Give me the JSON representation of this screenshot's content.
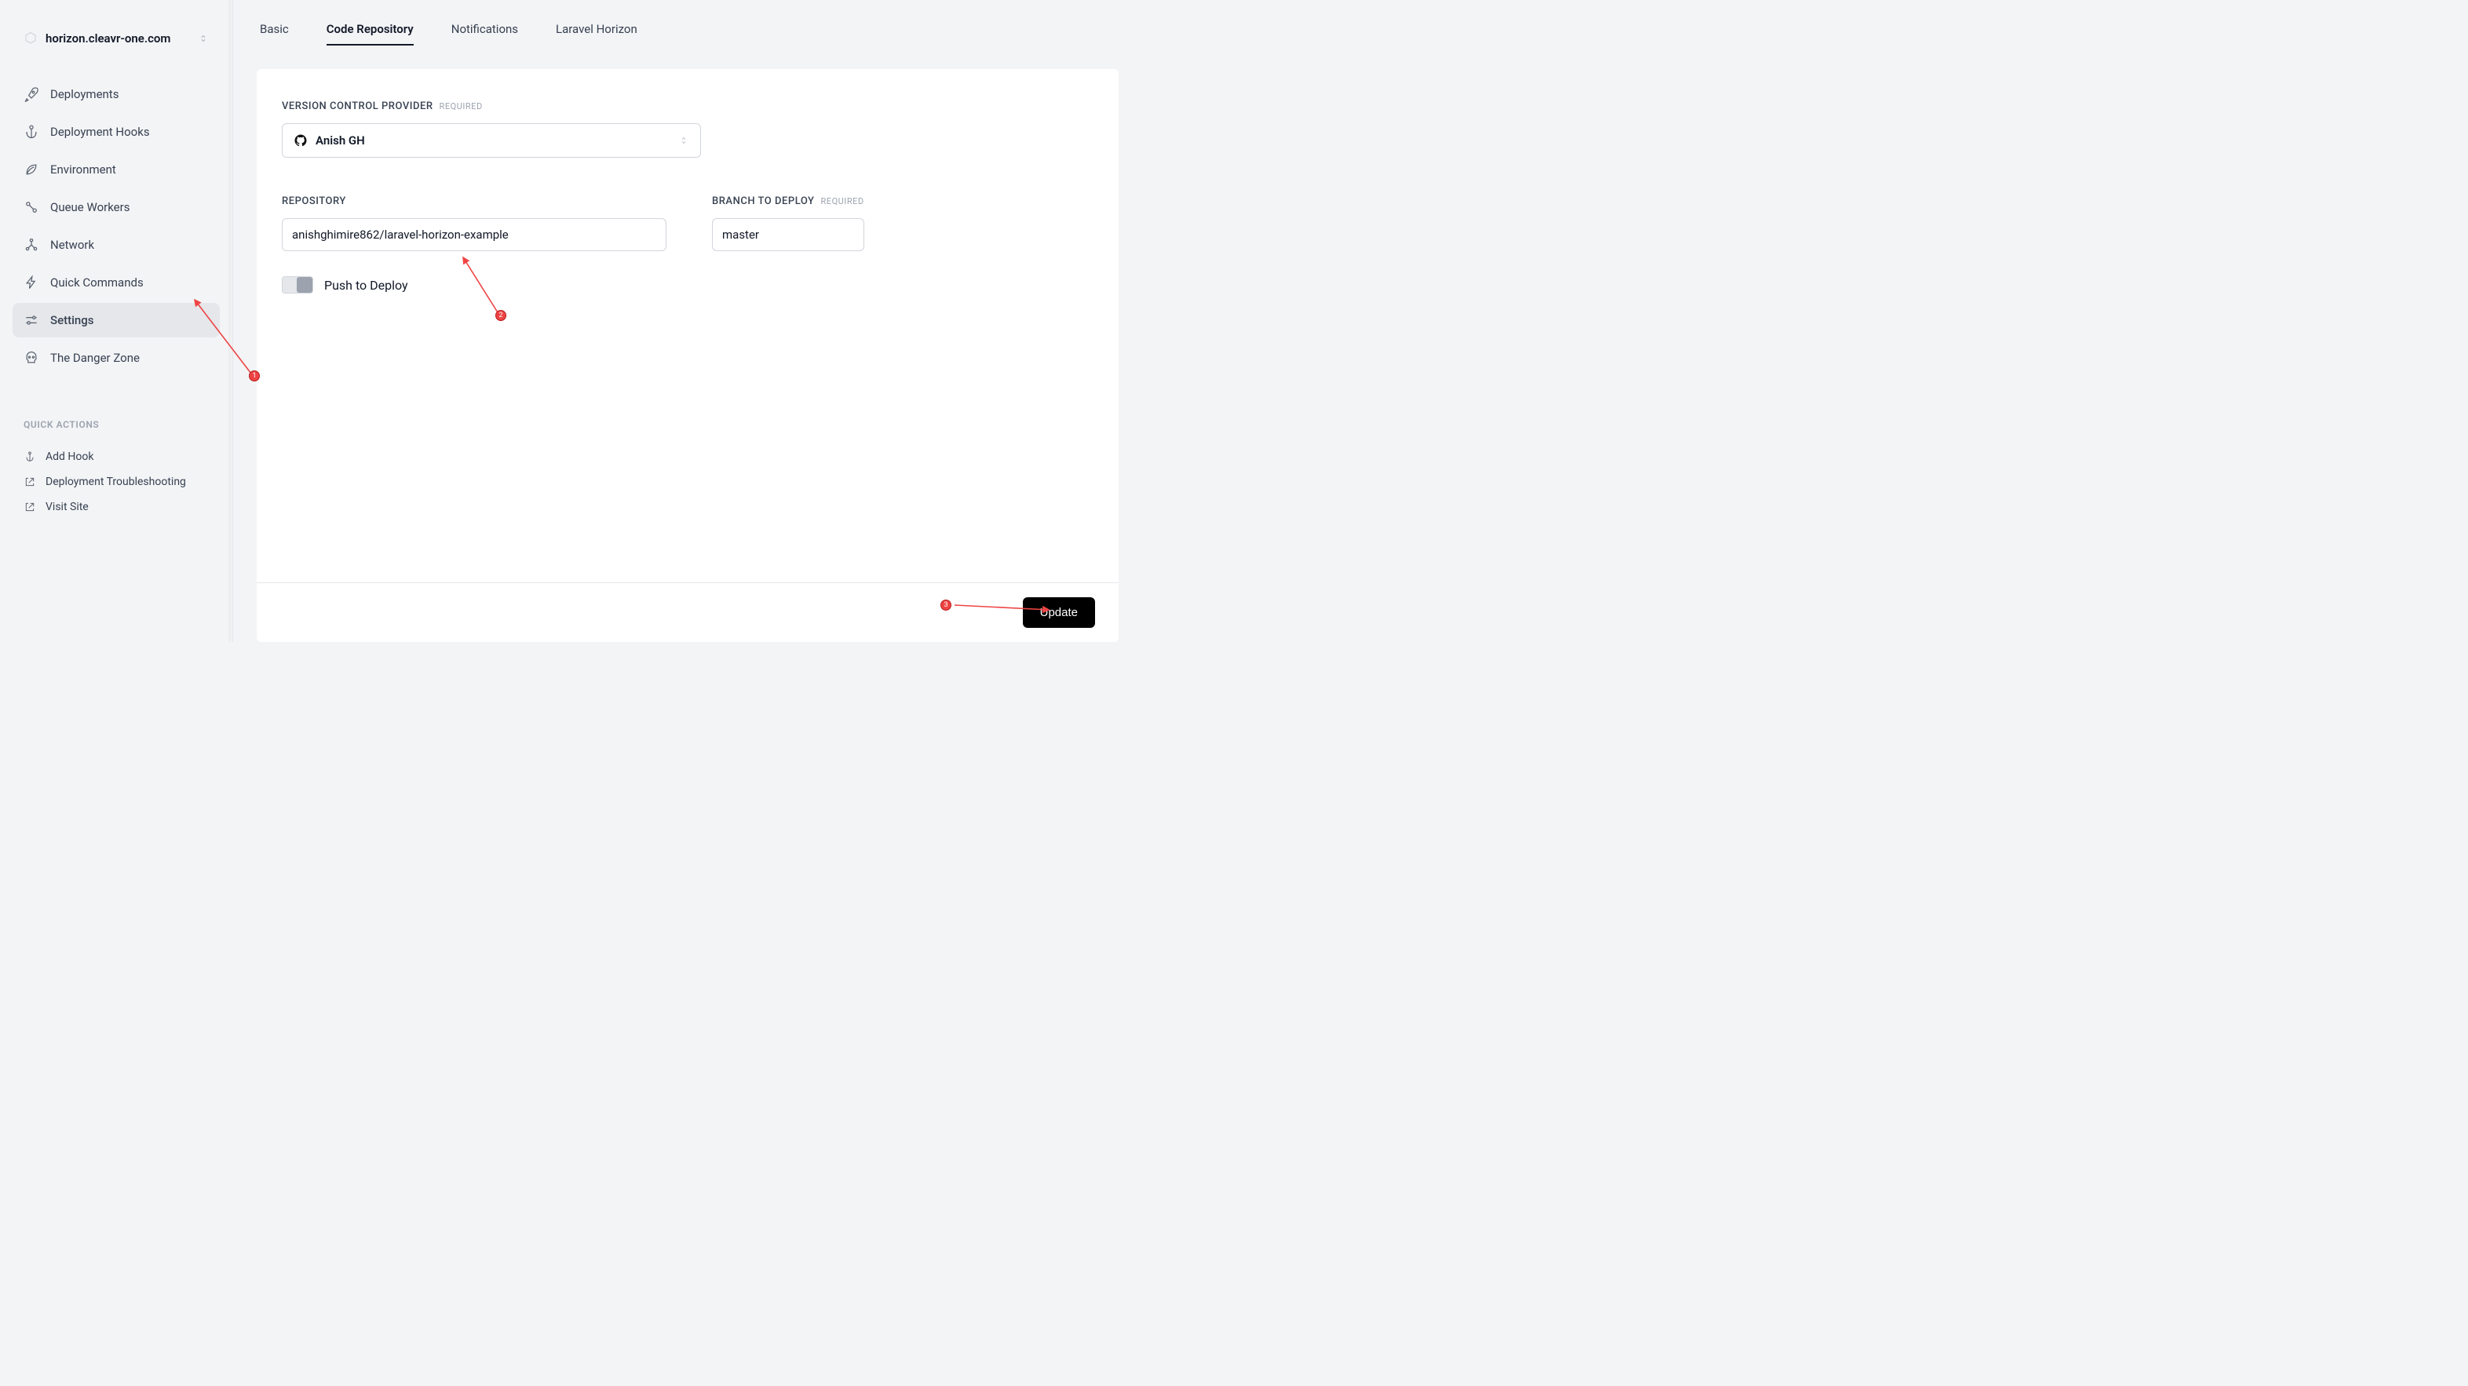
{
  "site": {
    "name": "horizon.cleavr-one.com"
  },
  "nav": {
    "items": [
      {
        "label": "Deployments"
      },
      {
        "label": "Deployment Hooks"
      },
      {
        "label": "Environment"
      },
      {
        "label": "Queue Workers"
      },
      {
        "label": "Network"
      },
      {
        "label": "Quick Commands"
      },
      {
        "label": "Settings"
      },
      {
        "label": "The Danger Zone"
      }
    ]
  },
  "quick_actions": {
    "title": "QUICK ACTIONS",
    "items": [
      {
        "label": "Add Hook"
      },
      {
        "label": "Deployment Troubleshooting"
      },
      {
        "label": "Visit Site"
      }
    ]
  },
  "tabs": [
    {
      "label": "Basic"
    },
    {
      "label": "Code Repository"
    },
    {
      "label": "Notifications"
    },
    {
      "label": "Laravel Horizon"
    }
  ],
  "form": {
    "vcp_label": "VERSION CONTROL PROVIDER",
    "required": "REQUIRED",
    "vcp_value": "Anish GH",
    "repo_label": "REPOSITORY",
    "repo_value": "anishghimire862/laravel-horizon-example",
    "branch_label": "BRANCH TO DEPLOY",
    "branch_value": "master",
    "push_label": "Push to Deploy",
    "update_button": "Update"
  },
  "annotations": {
    "n1": "1",
    "n2": "2",
    "n3": "3"
  }
}
